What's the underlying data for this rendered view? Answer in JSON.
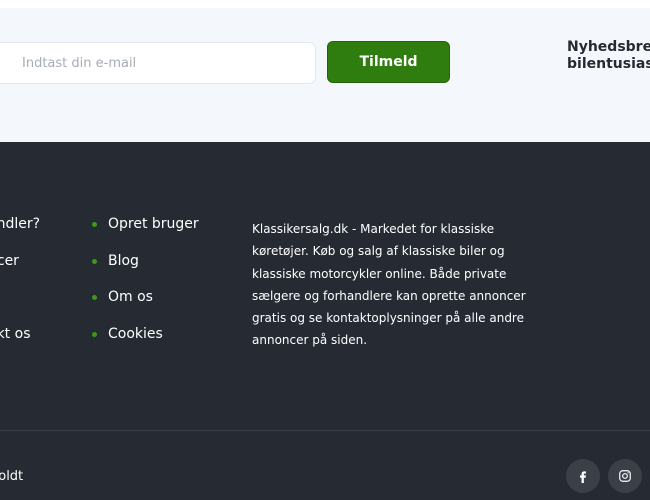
{
  "newsletter": {
    "email_placeholder": "Indtast din e-mail",
    "subscribe_label": "Tilmeld",
    "title_line1": "Nyhedsbrev",
    "title_line2": "bilentusiaste"
  },
  "footer": {
    "col1": [
      "andler?",
      "ncer",
      "akt os"
    ],
    "col2": [
      "Opret bruger",
      "Blog",
      "Om os",
      "Cookies"
    ],
    "about": "Klassikersalg.dk - Markedet for klassiske køretøjer. Køb og salg af klassiske biler og klassiske motorcykler online. Både private sælgere og forhandlere kan oprette annoncer gratis og se kontaktoplysninger på alle andre annoncer på siden.",
    "copyright": "holdt",
    "social": [
      "facebook-icon",
      "instagram-icon"
    ]
  },
  "colors": {
    "accent_green": "#2f7d0f",
    "footer_bg": "#252a33",
    "newsletter_bg": "#f4f8fc"
  }
}
